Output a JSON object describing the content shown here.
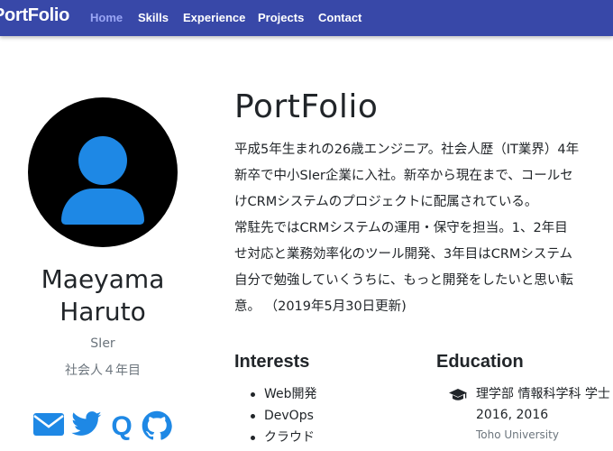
{
  "navbar": {
    "brand": "PortFolio",
    "links": [
      {
        "label": "Home",
        "active": true
      },
      {
        "label": "Skills"
      },
      {
        "label": "Experience"
      },
      {
        "label": "Projects"
      },
      {
        "label": "Contact"
      }
    ],
    "background": "#3848a8",
    "active_color": "#9aa6f5"
  },
  "profile": {
    "avatar_icon": "user-icon",
    "name_line1": "Maeyama",
    "name_line2": "Haruto",
    "role": "SIer",
    "tenure": "社会人４年目",
    "social": [
      "mail-icon",
      "twitter-icon",
      "qiita-icon",
      "github-icon"
    ],
    "accent": "#1e88e5"
  },
  "main": {
    "title": "PortFolio",
    "bio_lines": [
      "平成5年生まれの26歳エンジニア。社会人歴（IT業界）4年",
      "新卒で中小SIer企業に入社。新卒から現在まで、コールセ",
      "けCRMシステムのプロジェクトに配属されている。",
      "常駐先ではCRMシステムの運用・保守を担当。1、2年目",
      "せ対応と業務効率化のツール開発、3年目はCRMシステム",
      "自分で勉強していくうちに、もっと開発をしたいと思い転",
      "意。 （2019年5月30日更新)"
    ]
  },
  "interests": {
    "title": "Interests",
    "items": [
      "Web開発",
      "DevOps",
      "クラウド"
    ]
  },
  "education": {
    "title": "Education",
    "icon": "graduation-cap-icon",
    "degree": "理学部 情報科学科 学士",
    "years": "2016, 2016",
    "school": "Toho University"
  }
}
